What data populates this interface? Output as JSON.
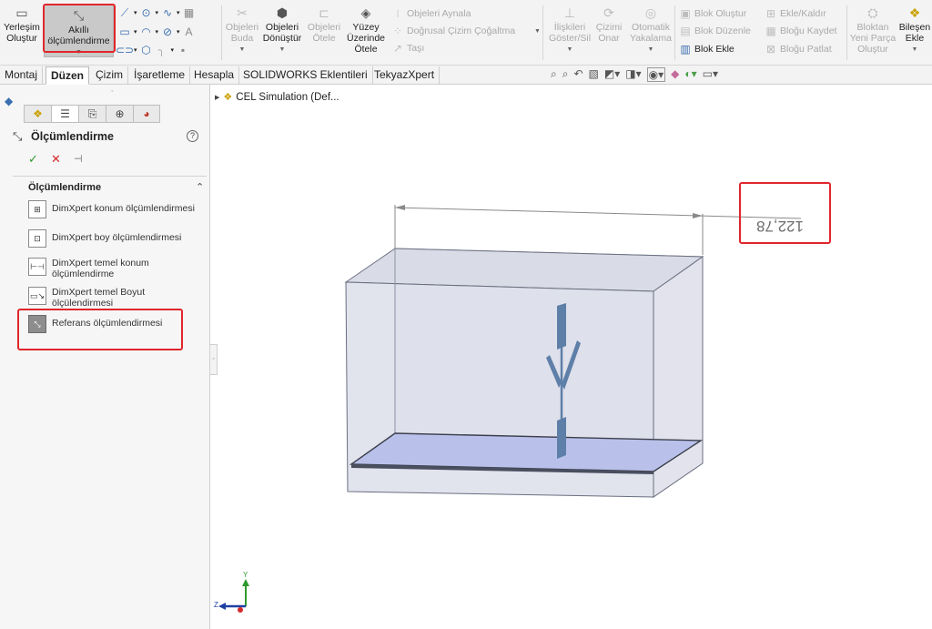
{
  "ribbon": {
    "place": "Yerleşim\nOluştur",
    "smart_dim": "Akıllı\nölçümlendirme",
    "trim": "Objeleri\nBuda",
    "convert": "Objeleri\nDönüştür",
    "offset": "Objeleri\nÖtele",
    "surface_offset": "Yüzey\nÜzerinde\nÖtele",
    "mirror": "Objeleri Aynala",
    "linear_pattern": "Doğrusal Çizim Çoğaltma",
    "move": "Taşı",
    "relations": "İlişkileri\nGöster/Sil",
    "repair": "Çizimi\nOnar",
    "autosnap": "Otomatik\nYakalama",
    "block_create": "Blok Oluştur",
    "block_edit": "Blok Düzenle",
    "block_insert": "Blok Ekle",
    "add_remove": "Ekle/Kaldır",
    "block_save": "Bloğu Kaydet",
    "block_explode": "Bloğu Patlat",
    "from_block": "Bloktan\nYeni Parça\nOluştur",
    "insert_component": "Bileşen\nEkle"
  },
  "tabs": [
    "Montaj",
    "Düzen",
    "Çizim",
    "İşaretleme",
    "Hesapla",
    "SOLIDWORKS Eklentileri",
    "TekyazXpert"
  ],
  "active_tab": "Düzen",
  "tree": {
    "root_label": "CEL Simulation (Def..."
  },
  "property_manager": {
    "title": "Ölçümlendirme",
    "help": "?",
    "ok": "✓",
    "cancel": "✕",
    "pin": "⊣",
    "section_title": "Ölçümlendirme",
    "options": [
      {
        "label": "DimXpert konum ölçümlendirmesi"
      },
      {
        "label": "DimXpert boy ölçümlendirmesi"
      },
      {
        "label": "DimXpert temel konum ölçümlendirme"
      },
      {
        "label": "DimXpert temel Boyut ölçülendirmesi"
      },
      {
        "label": "Referans ölçümlendirmesi"
      }
    ],
    "selected_option": "Referans ölçümlendirmesi"
  },
  "viewport": {
    "dimension_value": "122,78"
  },
  "triad": {
    "y": "Y",
    "z": "Z"
  },
  "colors": {
    "highlight_red": "#e0262b",
    "plate": "#b9c1ea",
    "box_edge": "#6a6f80",
    "flower_blue": "#5e7fa8"
  }
}
